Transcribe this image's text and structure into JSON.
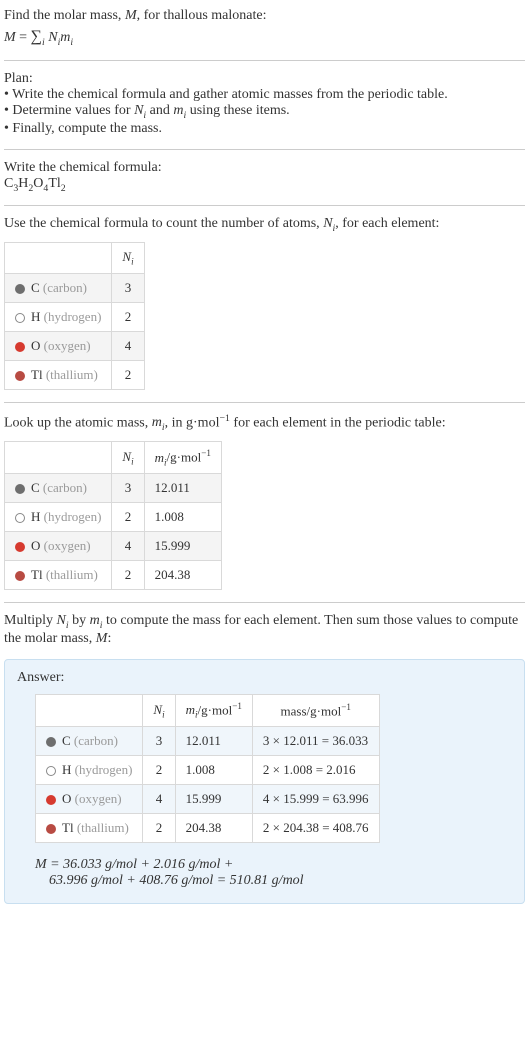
{
  "intro": {
    "line1_pre": "Find the molar mass, ",
    "line1_post": ", for thallous malonate:",
    "M": "M",
    "formula_img": "M = ∑ Nᵢmᵢ",
    "sigma_sub": "i"
  },
  "plan": {
    "heading": "Plan:",
    "items": [
      "• Write the chemical formula and gather atomic masses from the periodic table.",
      "• Determine values for Nᵢ and mᵢ using these items.",
      "• Finally, compute the mass."
    ]
  },
  "chem_formula": {
    "heading": "Write the chemical formula:",
    "formula_html": "C₃H₂O₄Tl₂"
  },
  "count": {
    "heading_pre": "Use the chemical formula to count the number of atoms, ",
    "heading_post": ", for each element:",
    "Ni": "Nᵢ",
    "header": [
      "",
      "Nᵢ"
    ],
    "rows": [
      {
        "color": "#6e6e6e",
        "outline": false,
        "sym": "C",
        "name": "(carbon)",
        "n": "3"
      },
      {
        "color": "#ffffff",
        "outline": true,
        "sym": "H",
        "name": "(hydrogen)",
        "n": "2"
      },
      {
        "color": "#d63a2f",
        "outline": false,
        "sym": "O",
        "name": "(oxygen)",
        "n": "4"
      },
      {
        "color": "#b84b43",
        "outline": false,
        "sym": "Tl",
        "name": "(thallium)",
        "n": "2"
      }
    ]
  },
  "lookup": {
    "heading_pre": "Look up the atomic mass, ",
    "heading_mid": ", in g·mol",
    "heading_post": " for each element in the periodic table:",
    "mi": "mᵢ",
    "neg1": "−1",
    "header": [
      "",
      "Nᵢ",
      "mᵢ/g·mol⁻¹"
    ],
    "rows": [
      {
        "color": "#6e6e6e",
        "outline": false,
        "sym": "C",
        "name": "(carbon)",
        "n": "3",
        "m": "12.011"
      },
      {
        "color": "#ffffff",
        "outline": true,
        "sym": "H",
        "name": "(hydrogen)",
        "n": "2",
        "m": "1.008"
      },
      {
        "color": "#d63a2f",
        "outline": false,
        "sym": "O",
        "name": "(oxygen)",
        "n": "4",
        "m": "15.999"
      },
      {
        "color": "#b84b43",
        "outline": false,
        "sym": "Tl",
        "name": "(thallium)",
        "n": "2",
        "m": "204.38"
      }
    ]
  },
  "multiply": {
    "text": "Multiply Nᵢ by mᵢ to compute the mass for each element. Then sum those values to compute the molar mass, M:"
  },
  "answer": {
    "label": "Answer:",
    "header": [
      "",
      "Nᵢ",
      "mᵢ/g·mol⁻¹",
      "mass/g·mol⁻¹"
    ],
    "rows": [
      {
        "color": "#6e6e6e",
        "outline": false,
        "sym": "C",
        "name": "(carbon)",
        "n": "3",
        "m": "12.011",
        "mass": "3 × 12.011 = 36.033"
      },
      {
        "color": "#ffffff",
        "outline": true,
        "sym": "H",
        "name": "(hydrogen)",
        "n": "2",
        "m": "1.008",
        "mass": "2 × 1.008 = 2.016"
      },
      {
        "color": "#d63a2f",
        "outline": false,
        "sym": "O",
        "name": "(oxygen)",
        "n": "4",
        "m": "15.999",
        "mass": "4 × 15.999 = 63.996"
      },
      {
        "color": "#b84b43",
        "outline": false,
        "sym": "Tl",
        "name": "(thallium)",
        "n": "2",
        "m": "204.38",
        "mass": "2 × 204.38 = 408.76"
      }
    ],
    "sum_line1": "M = 36.033 g/mol + 2.016 g/mol + ",
    "sum_line2": "63.996 g/mol + 408.76 g/mol = 510.81 g/mol"
  }
}
